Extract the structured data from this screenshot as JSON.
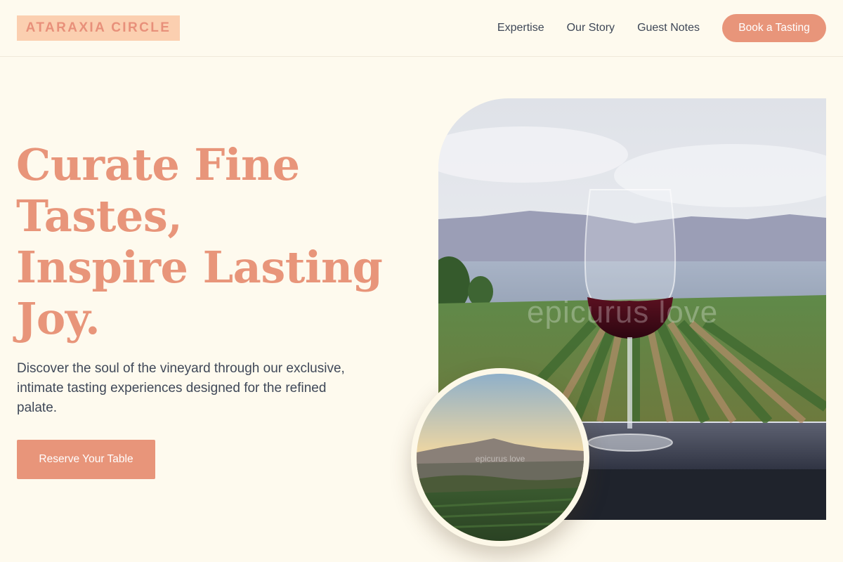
{
  "brand": {
    "name": "ATARAXIA CIRCLE"
  },
  "nav": {
    "links": [
      "Expertise",
      "Our Story",
      "Guest Notes"
    ],
    "cta": "Book a Tasting"
  },
  "hero": {
    "headline_lines": [
      "Curate Fine",
      "Tastes,",
      "Inspire Lasting",
      "Joy."
    ],
    "subtext": "Discover the soul of the vineyard through our exclusive, intimate tasting experiences designed for the refined palate.",
    "cta": "Reserve Your Table"
  },
  "images": {
    "main_watermark": "epicurus love",
    "inset_watermark": "epicurus love"
  },
  "colors": {
    "background": "#fefaee",
    "accent": "#e8957a",
    "logo_bg": "#fbcfb0",
    "text": "#3f4858"
  }
}
